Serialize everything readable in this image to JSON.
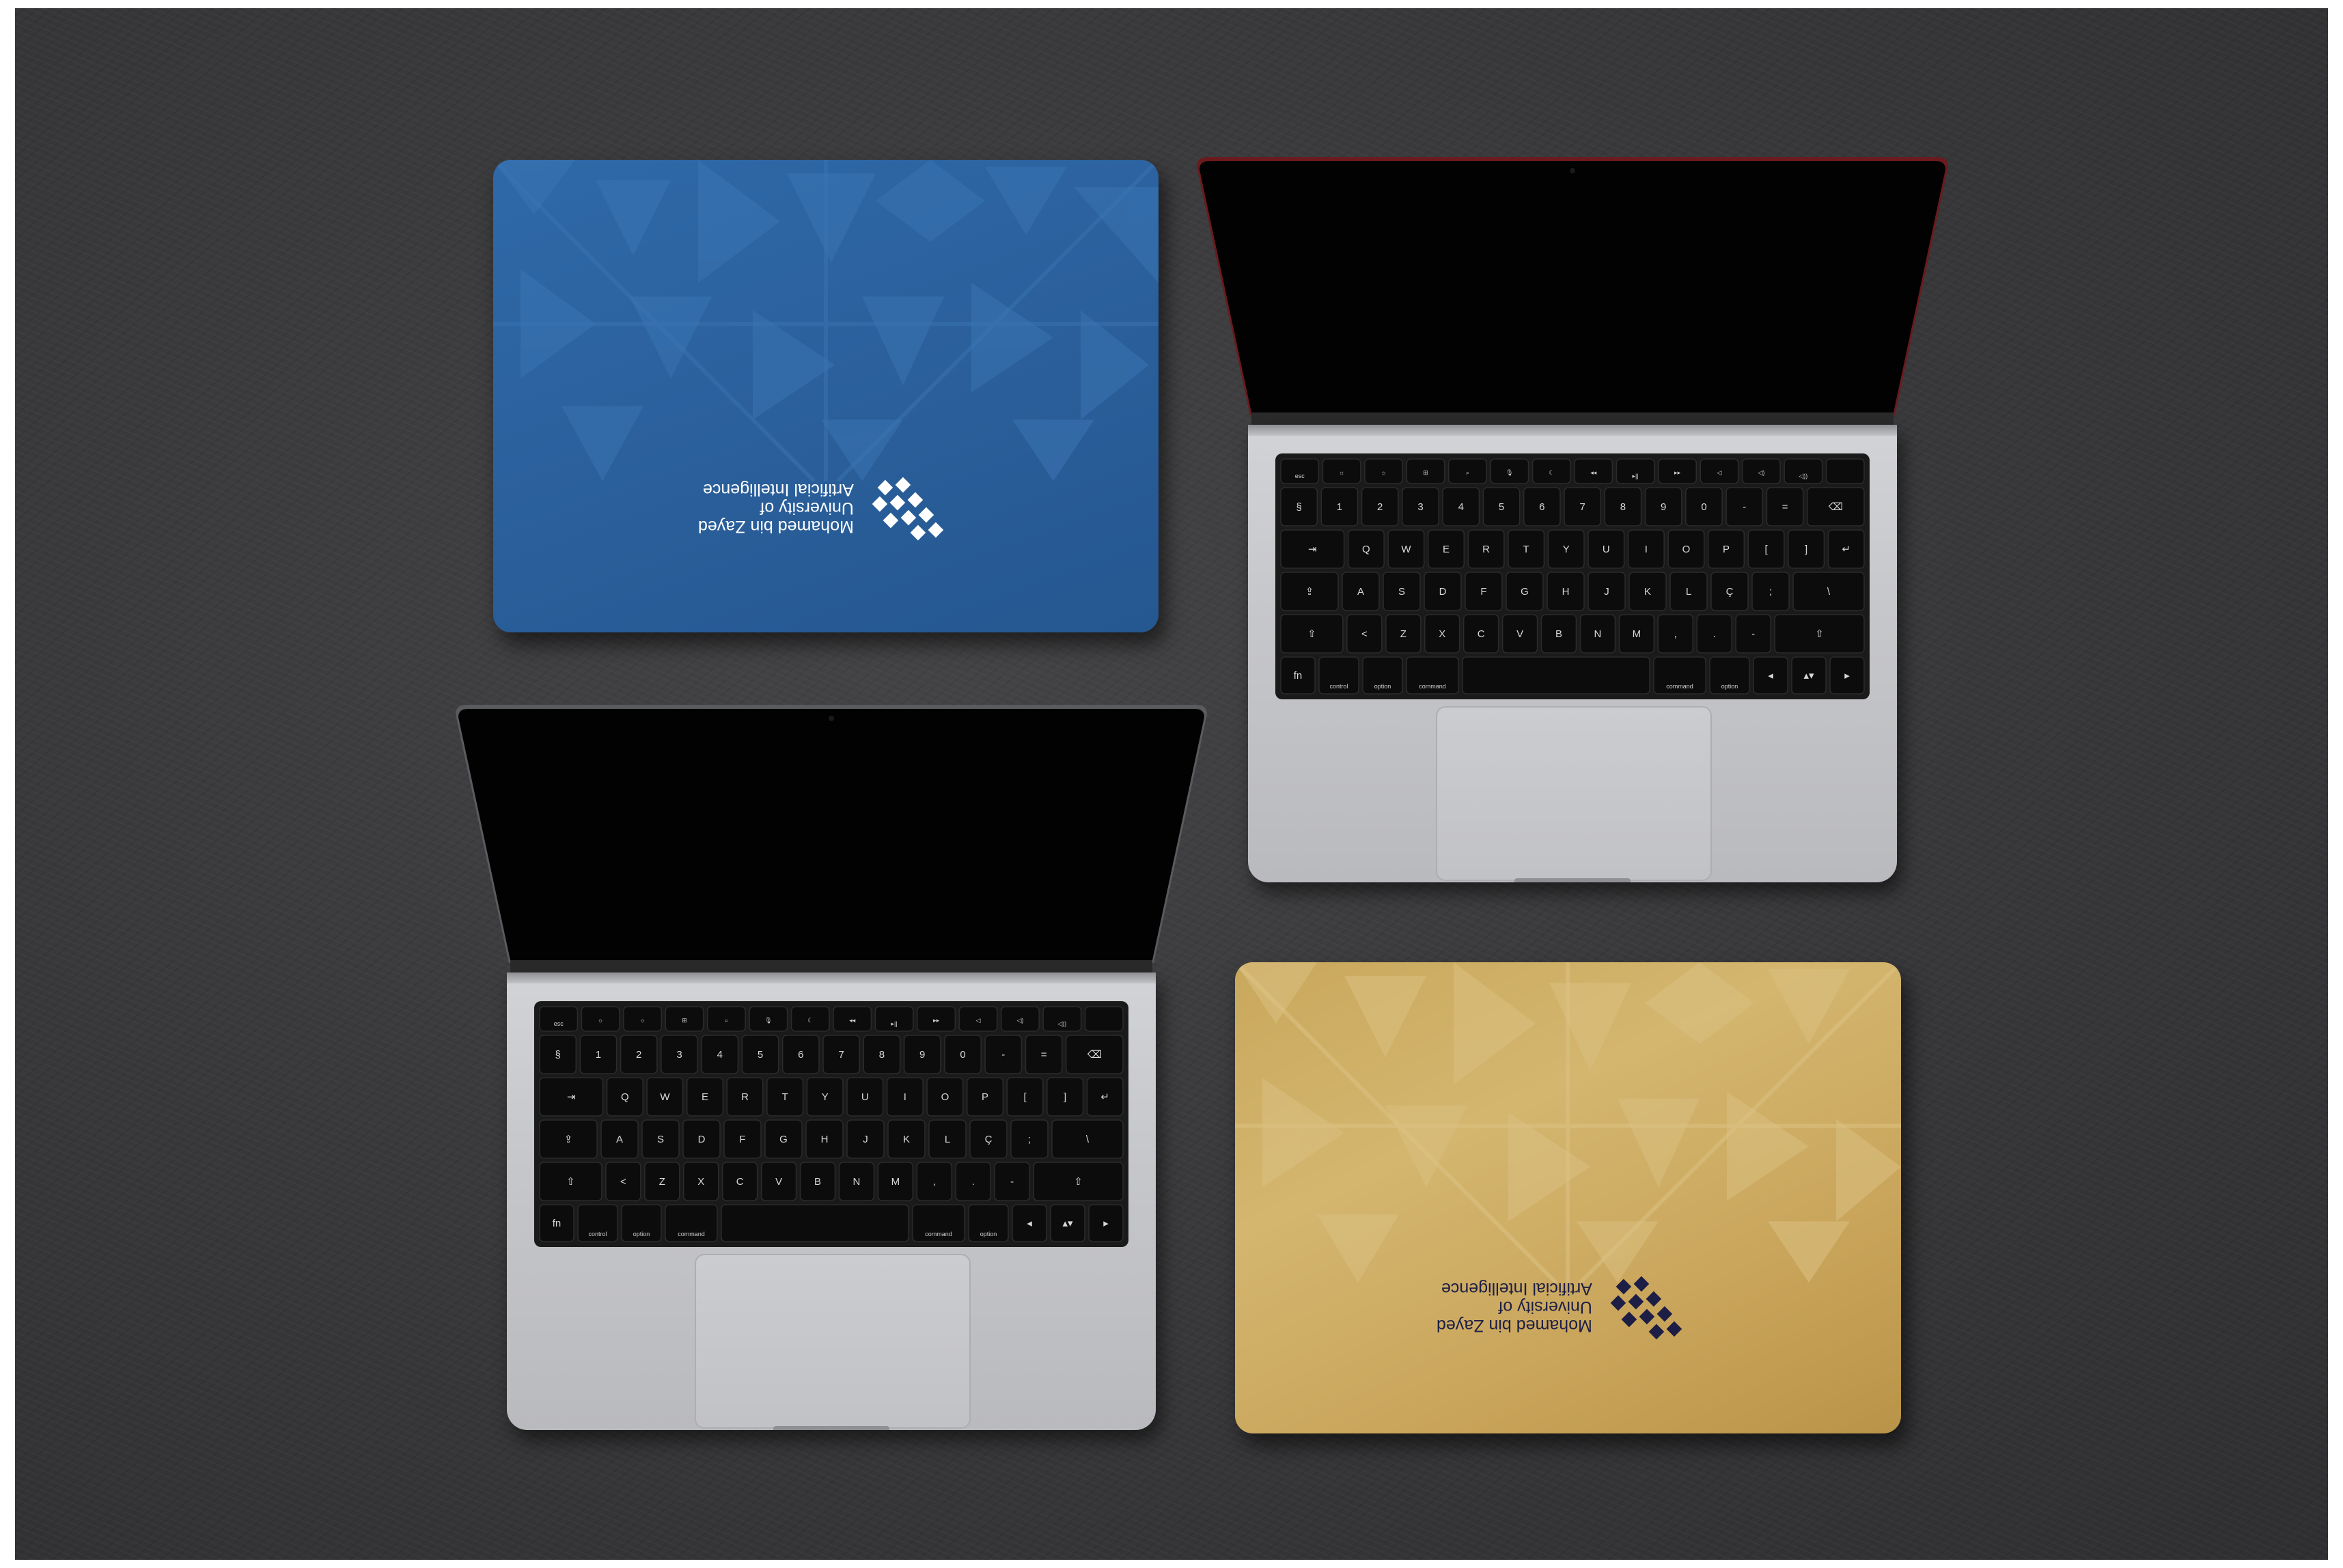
{
  "background": {
    "surface_color": "#3a3a3c",
    "frame_color": "#ffffff"
  },
  "laptops": [
    {
      "position": "top-left",
      "view": "closed-lid",
      "lid_color": "#2c63a1",
      "logo_color": "#ffffff"
    },
    {
      "position": "top-right",
      "view": "open",
      "body_color": "#c6c7ca",
      "screen_color": "#000000"
    },
    {
      "position": "bottom-left",
      "view": "open",
      "body_color": "#c6c7ca",
      "screen_color": "#000000"
    },
    {
      "position": "bottom-right",
      "view": "closed-lid",
      "lid_color": "#ccab5f",
      "logo_color": "#1d1e45"
    }
  ],
  "branding": {
    "line1": "Mohamed bin Zayed",
    "line2": "University of",
    "line3": "Artificial Intelligence",
    "orientation": "upside-down"
  },
  "keyboard": {
    "fn_row": [
      "esc",
      "☼",
      "☼",
      "⊞",
      "⌕",
      "🎙",
      "☾",
      "◂◂",
      "▸||",
      "▸▸",
      "◁",
      "◁)",
      "◁))",
      ""
    ],
    "num_row": [
      "§",
      "1",
      "2",
      "3",
      "4",
      "5",
      "6",
      "7",
      "8",
      "9",
      "0",
      "-",
      "=",
      "⌫"
    ],
    "q_row": [
      "⇥",
      "Q",
      "W",
      "E",
      "R",
      "T",
      "Y",
      "U",
      "I",
      "O",
      "P",
      "[",
      "]",
      "↵"
    ],
    "a_row": [
      "⇪",
      "A",
      "S",
      "D",
      "F",
      "G",
      "H",
      "J",
      "K",
      "L",
      "Ç",
      ";",
      "\\"
    ],
    "z_row": [
      "⇧",
      "<",
      "Z",
      "X",
      "C",
      "V",
      "B",
      "N",
      "M",
      ",",
      ".",
      "-",
      "⇧"
    ],
    "bottom_row": [
      "fn",
      "control",
      "option",
      "command",
      "",
      "command",
      "option",
      "◂",
      "▴▾",
      "▸"
    ]
  }
}
